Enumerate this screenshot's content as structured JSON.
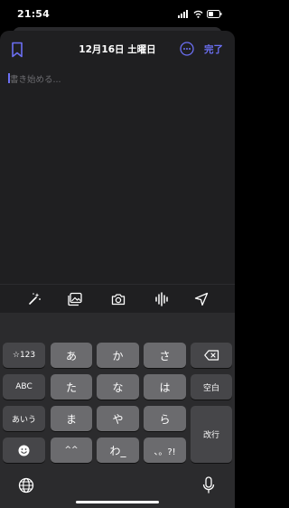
{
  "status_bar": {
    "time": "21:54"
  },
  "header": {
    "title": "12月16日 土曜日",
    "done_label": "完了",
    "accent": "#6b6ff3"
  },
  "editor": {
    "placeholder": "書き始める..."
  },
  "toolbar": {
    "icons": [
      "magic-wand-icon",
      "photo-library-icon",
      "camera-icon",
      "audio-wave-icon",
      "location-arrow-icon"
    ]
  },
  "keyboard": {
    "left": [
      "☆123",
      "ABC",
      "あいう"
    ],
    "main": [
      "あ",
      "か",
      "さ",
      "た",
      "な",
      "は",
      "ま",
      "や",
      "ら",
      "^^",
      "わ_",
      "、。?!"
    ],
    "right": {
      "space": "空白",
      "return": "改行"
    }
  }
}
